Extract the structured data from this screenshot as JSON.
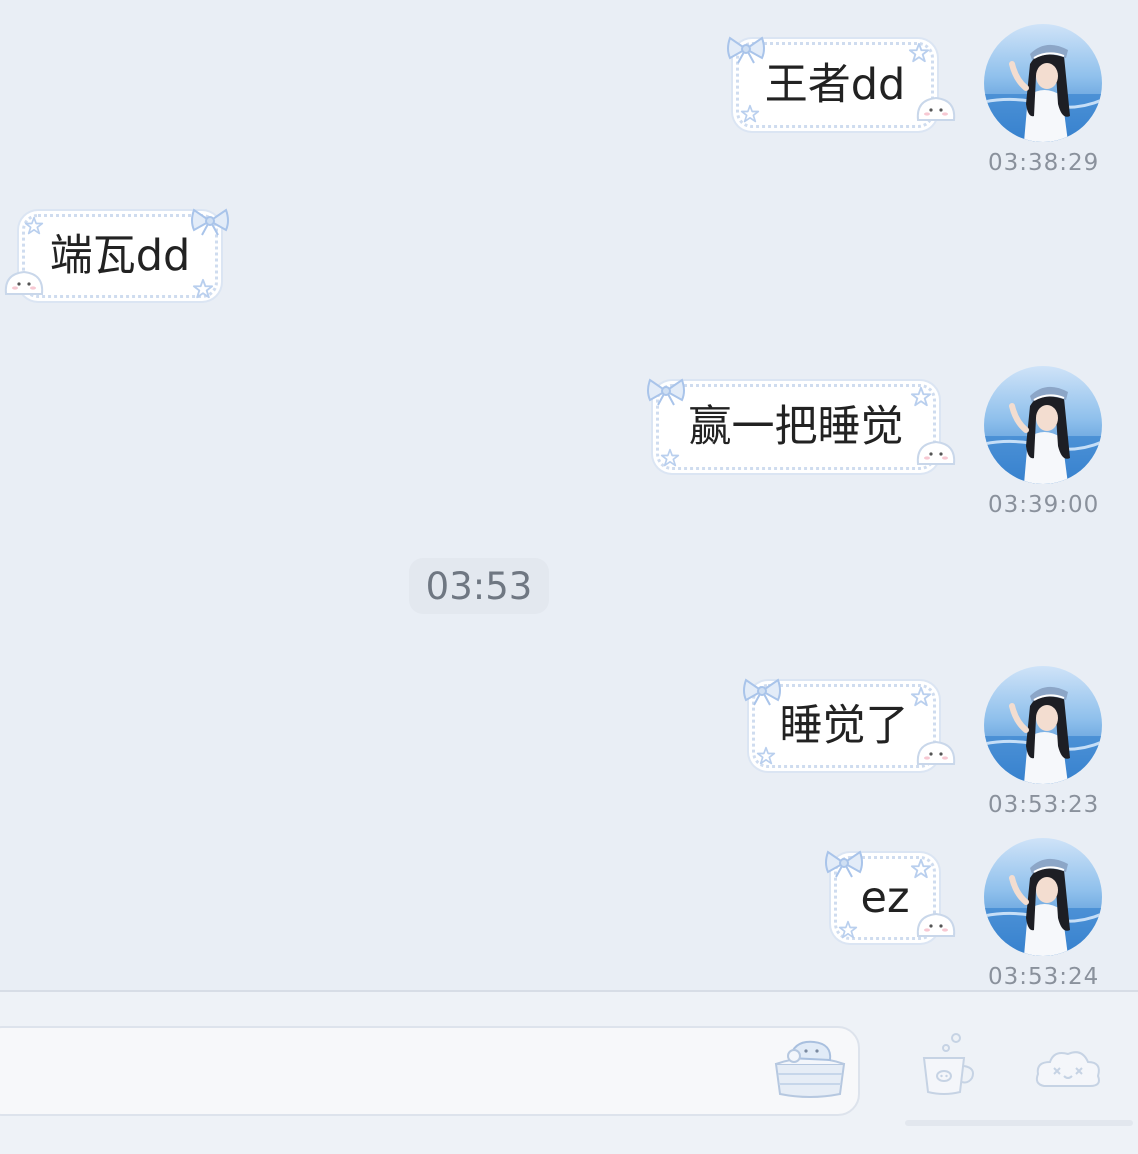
{
  "messages": [
    {
      "side": "right",
      "text": "王者dd",
      "time": "03:38:29"
    },
    {
      "side": "left",
      "text": "端瓦dd",
      "time": ""
    },
    {
      "side": "right",
      "text": "赢一把睡觉",
      "time": "03:39:00"
    },
    {
      "side": "right",
      "text": "睡觉了",
      "time": "03:53:23"
    },
    {
      "side": "right",
      "text": "ez",
      "time": "03:53:24"
    }
  ],
  "time_divider": "03:53",
  "input": {
    "value": "",
    "placeholder": ""
  },
  "icons": {
    "sticker": "cake-sticker-icon",
    "cup": "cup-icon",
    "emoji": "cloud-emoji-icon"
  },
  "colors": {
    "background": "#e9eef5",
    "bubble": "#ffffff",
    "bubble_border": "#cfdcef",
    "timestamp": "#8a919c",
    "accent": "#a9c4ea"
  }
}
